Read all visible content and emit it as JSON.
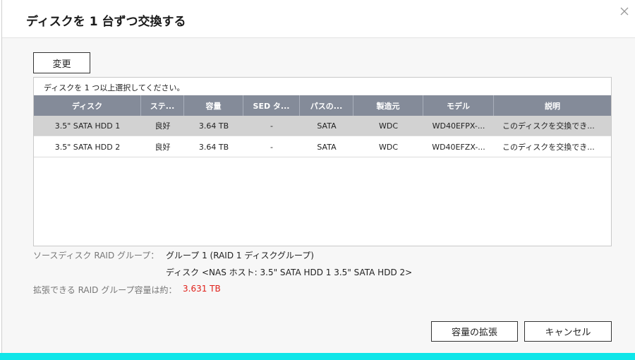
{
  "dialog": {
    "title": "ディスクを 1 台ずつ交換する",
    "close_symbol": "×"
  },
  "toolbar": {
    "change_label": "変更"
  },
  "table": {
    "hint": "ディスクを 1 つ以上選択してください。",
    "headers": [
      "ディスク",
      "ステ...",
      "容量",
      "SED タ...",
      "パスの...",
      "製造元",
      "モデル",
      "説明"
    ],
    "rows": [
      [
        "3.5\" SATA HDD 1",
        "良好",
        "3.64 TB",
        "-",
        "SATA",
        "WDC",
        "WD40EFPX-...",
        "このディスクを交換でき..."
      ],
      [
        "3.5\" SATA HDD 2",
        "良好",
        "3.64 TB",
        "-",
        "SATA",
        "WDC",
        "WD40EFZX-...",
        "このディスクを交換でき..."
      ]
    ]
  },
  "info": {
    "source_label": "ソースディスク RAID グループ：",
    "source_value": "グループ 1 (RAID 1 ディスクグループ)",
    "disk_value": "ディスク <NAS ホスト: 3.5\" SATA HDD 1 3.5\" SATA HDD 2>",
    "capacity_label": "拡張できる RAID グループ容量は約：",
    "capacity_value": "3.631 TB"
  },
  "footer": {
    "expand_label": "容量の拡張",
    "cancel_label": "キャンセル"
  },
  "colors": {
    "header_bg": "#848b99",
    "selected_row": "#d2d2d2",
    "capacity_value": "#e0201a",
    "bottom_bar": "#0fe6e9"
  },
  "icons": {
    "close": "close-icon"
  }
}
